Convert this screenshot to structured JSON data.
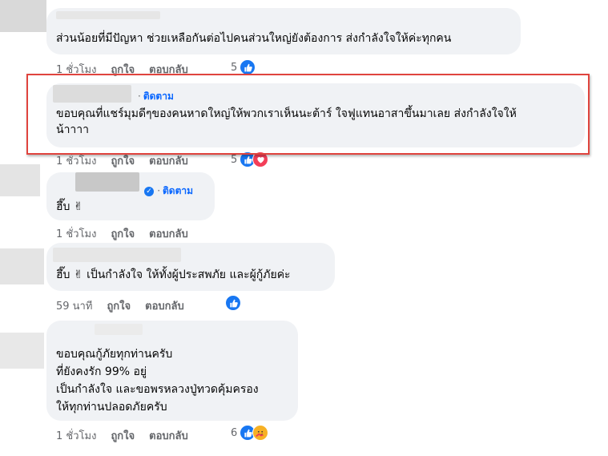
{
  "follow_label": "ติดตาม",
  "comments": [
    {
      "text": "ส่วนน้อยที่มีปัญหา ช่วยเหลือกันต่อไปคนส่วนใหญ่ยังต้องการ ส่งกำลังใจให้ค่ะทุกคน",
      "time": "1 ชั่วโมง",
      "like": "ถูกใจ",
      "reply": "ตอบกลับ",
      "reactions": "5"
    },
    {
      "text": "ขอบคุณที่แชร์มุมดีๆของคนหาดใหญ่ให้พวกเราเห็นนะต้าร์ ใจฟูแทนอาสาขึ้นมาเลย ส่งกำลังใจให้\nน้าาาา",
      "time": "1 ชั่วโมง",
      "like": "ถูกใจ",
      "reply": "ตอบกลับ",
      "reactions": "5"
    },
    {
      "text": "ฮึ๊บ ✌",
      "time": "1 ชั่วโมง",
      "like": "ถูกใจ",
      "reply": "ตอบกลับ"
    },
    {
      "text": "ฮึ๊บ ✌ เป็นกำลังใจ ให้ทั้งผู้ประสพภัย และผู้กู้ภัยค่ะ",
      "time": "59 นาที",
      "like": "ถูกใจ",
      "reply": "ตอบกลับ"
    },
    {
      "text": "ขอบคุณกู้ภัยทุกท่านครับ\nที่ยังคงรัก 99% อยู่\nเป็นกำลังใจ และขอพรหลวงปู่ทวดคุ้มครอง\nให้ทุกท่านปลอดภัยครับ",
      "time": "1 ชั่วโมง",
      "like": "ถูกใจ",
      "reply": "ตอบกลับ",
      "reactions": "6"
    }
  ],
  "colors": {
    "bubble": "#f0f2f5",
    "link": "#0866ff",
    "meta": "#65676b",
    "highlight": "#e0443e"
  }
}
